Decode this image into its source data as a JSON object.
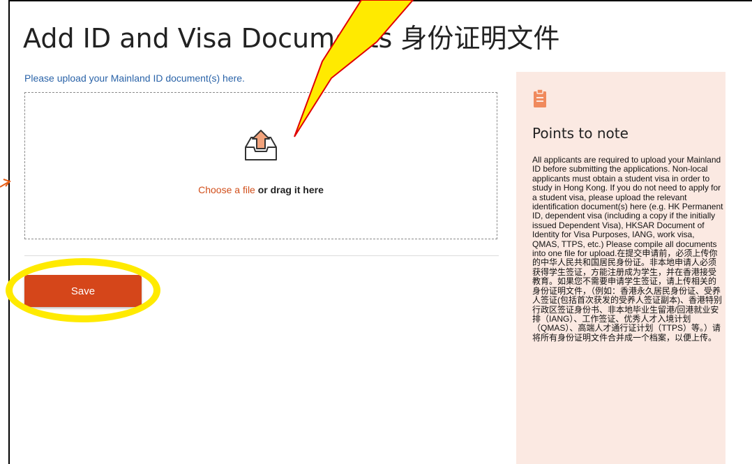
{
  "page": {
    "title": "Add ID and Visa Documents 身份证明文件"
  },
  "upload": {
    "hint": "Please upload your Mainland ID document(s) here.",
    "choose_label": "Choose a file",
    "drag_label": " or drag it here",
    "icon": "upload-tray-icon"
  },
  "actions": {
    "save_label": "Save"
  },
  "notes": {
    "icon": "clipboard-icon",
    "title": "Points to note",
    "body": "All applicants are required to upload your Mainland ID before submitting the applications. Non-local applicants must obtain a student visa in order to study in Hong Kong. If you do not need to apply for a student visa, please upload the relevant identification document(s) here (e.g. HK Permanent ID, dependent visa (including a copy if the initially issued Dependent Visa), HKSAR Document of Identity for Visa Purposes, IANG, work visa, QMAS, TTPS, etc.) Please compile all documents into one file for upload.在提交申请前，必须上传你的中华人民共和国居民身份证。非本地申请人必须获得学生签证，方能注册成为学生，并在香港接受教育。如果您不需要申请学生签证，请上传相关的身份证明文件，（例如：香港永久居民身份证、受养人签证(包括首次获发的受养人签证副本)、香港特别行政区签证身份书、非本地毕业生留港/回港就业安排（IANG）、工作签证、优秀人才入境计划（QMAS）、高端人才通行证计划（TTPS）等。）请将所有身份证明文件合并成一个档案，以便上传。"
  },
  "colors": {
    "accent": "#d5461a",
    "link": "#2a63a8",
    "panel": "#fbe9e2",
    "annotation": "#ffea00"
  }
}
